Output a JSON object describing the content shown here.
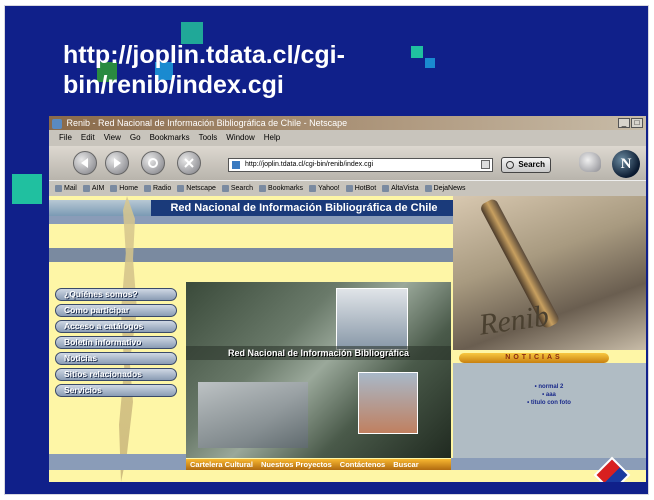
{
  "slide": {
    "title": "http://joplin.tdata.cl/cgi-bin/renib/index.cgi",
    "colors": {
      "background": "#10208a",
      "deco_teal": "#20a898",
      "deco_green": "#2a8a40",
      "deco_blue": "#1a8ad0"
    }
  },
  "browser": {
    "window_title": "Renib - Red Nacional de Información Bibliográfica de Chile - Netscape",
    "menu": [
      "File",
      "Edit",
      "View",
      "Go",
      "Bookmarks",
      "Tools",
      "Window",
      "Help"
    ],
    "url": "http://joplin.tdata.cl/cgi-bin/renib/index.cgi",
    "search_label": "Search",
    "personal_toolbar": [
      "Mail",
      "AIM",
      "Home",
      "Radio",
      "Netscape",
      "Search",
      "Bookmarks",
      "Yahoo!",
      "HotBot",
      "AltaVista",
      "DejaNews"
    ]
  },
  "site": {
    "banner": "Red Nacional de Información Bibliográfica de Chile",
    "menu": [
      "¿Quiénes somos?",
      "Como participar",
      "Acceso a catálogos",
      "Boletín informativo",
      "Noticias",
      "Sitios relacionados",
      "Servicios"
    ],
    "photo_caption": "Red Nacional de Información Bibliográfica",
    "logo_text": "Renib",
    "news_header": "NOTICIAS",
    "news_items": [
      "• normal 2",
      "• aaa",
      "• titulo con foto"
    ],
    "footer_links": [
      "Cartelera Cultural",
      "Nuestros Proyectos",
      "Contáctenos",
      "Buscar"
    ]
  }
}
